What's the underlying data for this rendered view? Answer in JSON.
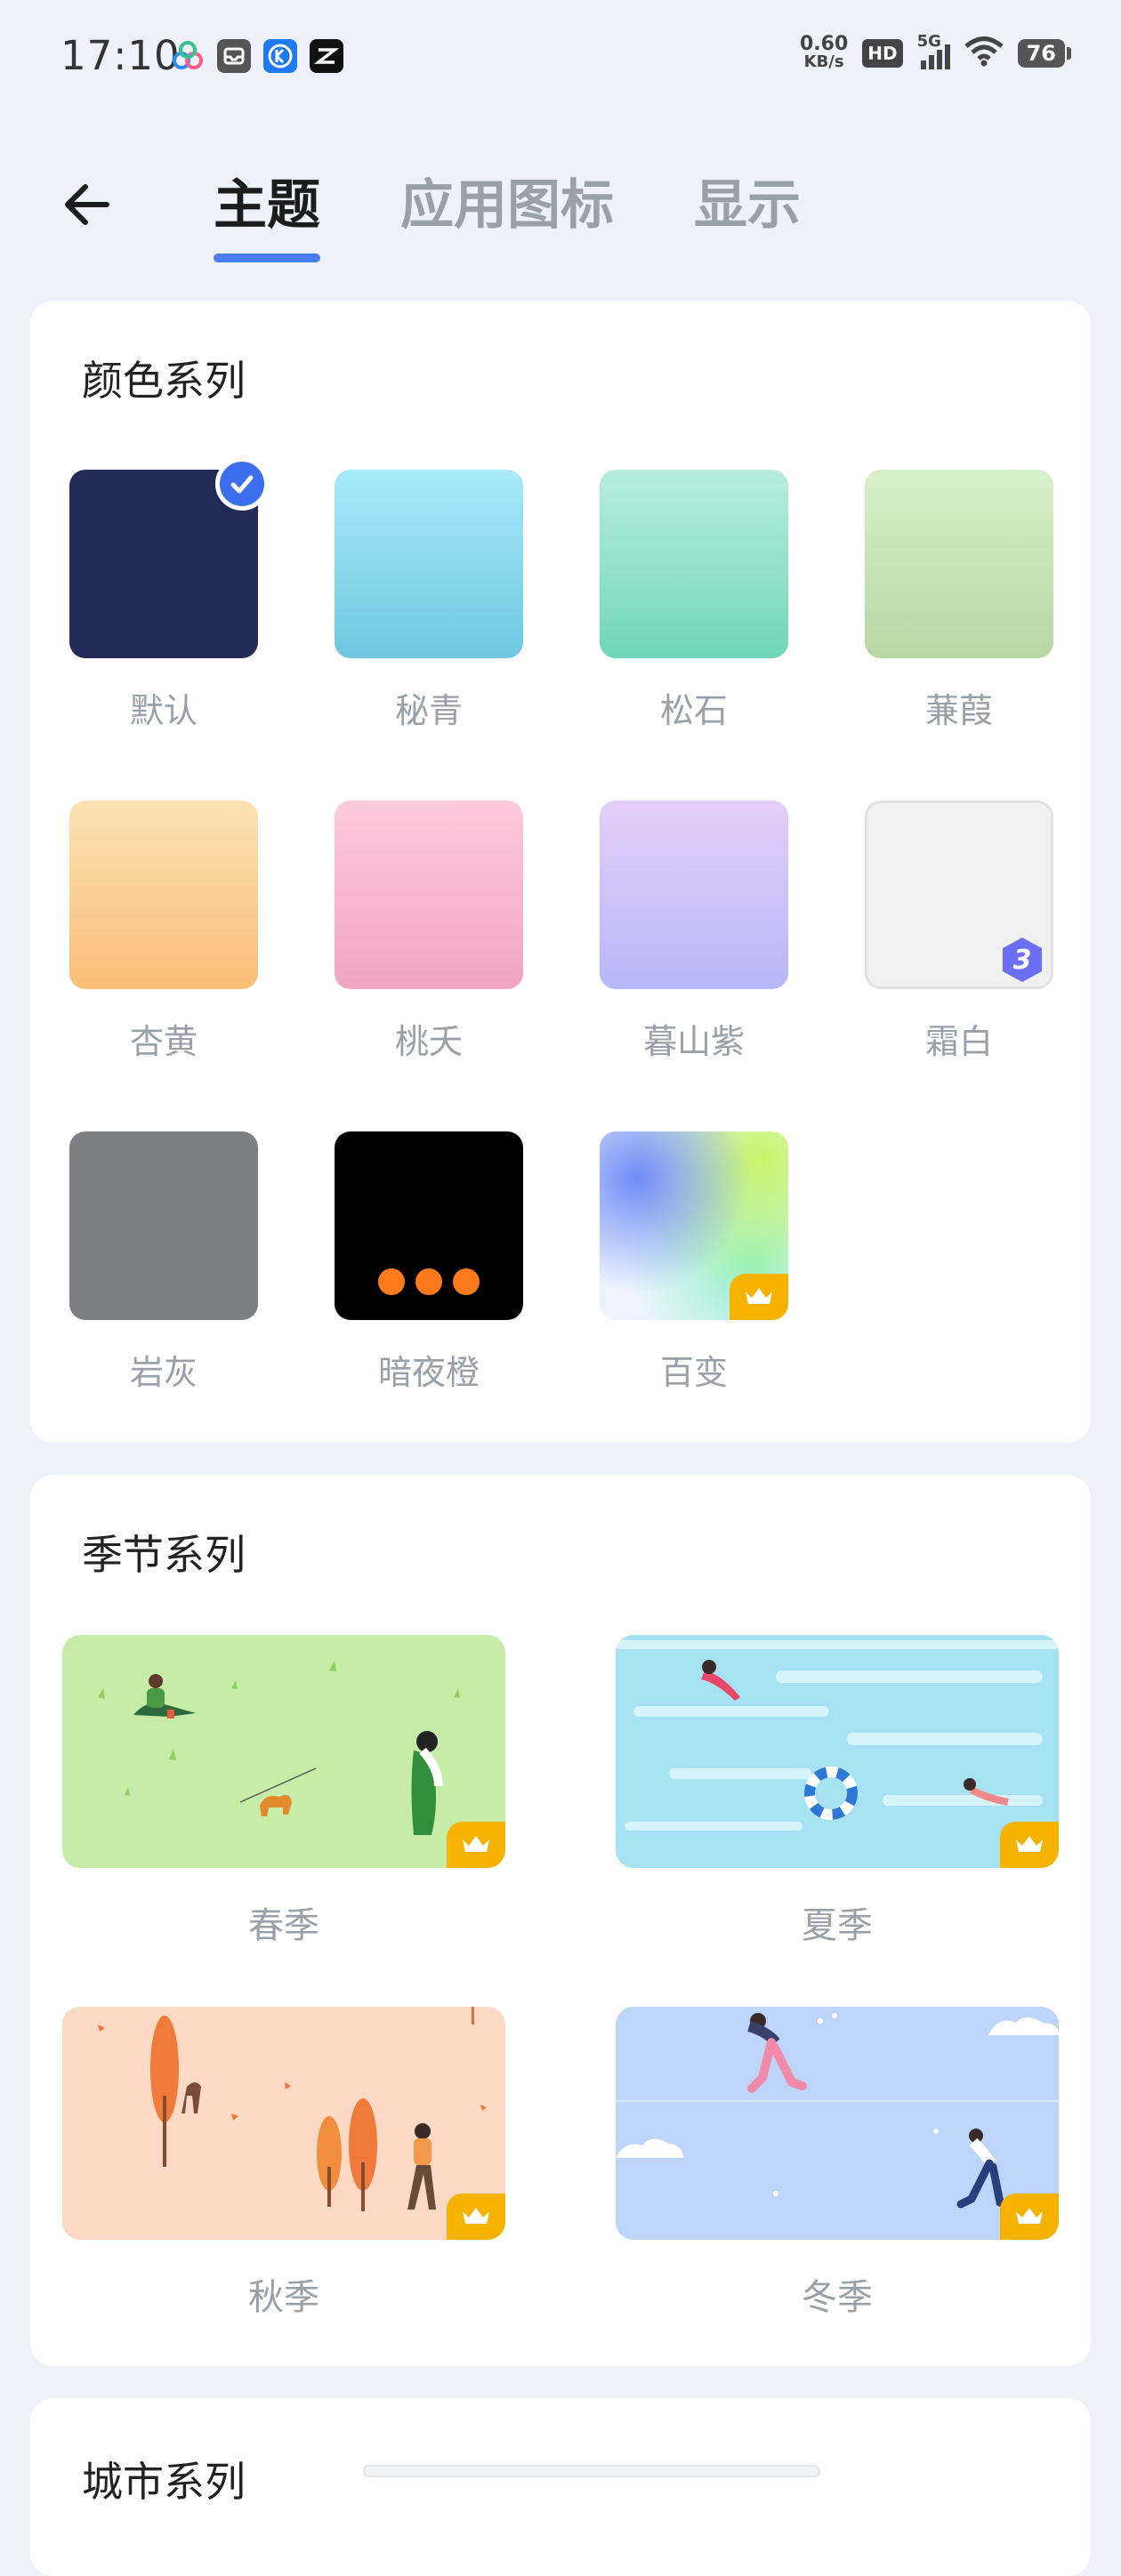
{
  "status_bar": {
    "time": "17:10",
    "apps": [
      "baidu-netdisk-icon",
      "inbox-app-icon",
      "kugou-icon",
      "capcut-icon"
    ],
    "net_speed_value": "0.60",
    "net_speed_unit": "KB/s",
    "hd_badge": "HD",
    "signal_label": "5G",
    "battery": "76"
  },
  "header": {
    "tabs": [
      {
        "label": "主题",
        "active": true
      },
      {
        "label": "应用图标",
        "active": false
      },
      {
        "label": "显示",
        "active": false
      }
    ]
  },
  "color_series": {
    "title": "颜色系列",
    "items": [
      {
        "label": "默认",
        "selected": true
      },
      {
        "label": "秘青"
      },
      {
        "label": "松石"
      },
      {
        "label": "蒹葭"
      },
      {
        "label": "杏黄"
      },
      {
        "label": "桃夭"
      },
      {
        "label": "暮山紫"
      },
      {
        "label": "霜白",
        "badge": "3"
      },
      {
        "label": "岩灰"
      },
      {
        "label": "暗夜橙"
      },
      {
        "label": "百变",
        "premium": true
      }
    ]
  },
  "season_series": {
    "title": "季节系列",
    "items": [
      {
        "label": "春季",
        "premium": true
      },
      {
        "label": "夏季",
        "premium": true
      },
      {
        "label": "秋季",
        "premium": true
      },
      {
        "label": "冬季",
        "premium": true
      }
    ]
  },
  "city_series": {
    "title": "城市系列"
  },
  "colors": {
    "accent": "#3c6ff0",
    "tab_underline": "#4a7ef0",
    "premium_badge": "#f5b300",
    "default_swatch": "#222b55"
  }
}
